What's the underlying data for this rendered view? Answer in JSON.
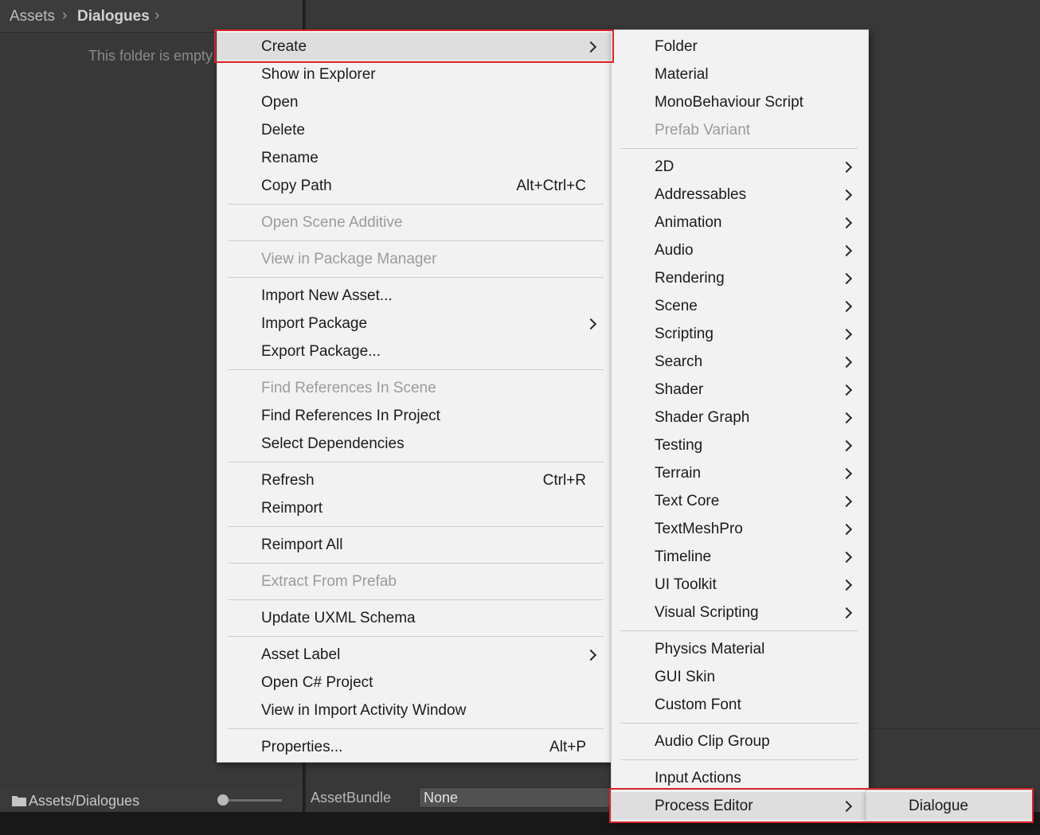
{
  "breadcrumb": {
    "root": "Assets",
    "current": "Dialogues"
  },
  "project": {
    "empty_message": "This folder is empty",
    "bottom_path": "Assets/Dialogues",
    "folder_icon": "folder-icon"
  },
  "inspector": {
    "assetbundle_label": "AssetBundle",
    "assetbundle_value": "None"
  },
  "context_menu": {
    "items": [
      {
        "label": "Create",
        "submenu": true,
        "highlighted": true
      },
      {
        "label": "Show in Explorer"
      },
      {
        "label": "Open"
      },
      {
        "label": "Delete"
      },
      {
        "label": "Rename"
      },
      {
        "label": "Copy Path",
        "shortcut": "Alt+Ctrl+C"
      },
      {
        "label": "Open Scene Additive",
        "disabled": true
      },
      {
        "label": "View in Package Manager",
        "disabled": true
      },
      {
        "label": "Import New Asset..."
      },
      {
        "label": "Import Package",
        "submenu": true
      },
      {
        "label": "Export Package..."
      },
      {
        "label": "Find References In Scene",
        "disabled": true
      },
      {
        "label": "Find References In Project"
      },
      {
        "label": "Select Dependencies"
      },
      {
        "label": "Refresh",
        "shortcut": "Ctrl+R"
      },
      {
        "label": "Reimport"
      },
      {
        "label": "Reimport All"
      },
      {
        "label": "Extract From Prefab",
        "disabled": true
      },
      {
        "label": "Update UXML Schema"
      },
      {
        "label": "Asset Label",
        "submenu": true
      },
      {
        "label": "Open C# Project"
      },
      {
        "label": "View in Import Activity Window"
      },
      {
        "label": "Properties...",
        "shortcut": "Alt+P"
      }
    ]
  },
  "create_submenu": {
    "items": [
      {
        "label": "Folder"
      },
      {
        "label": "Material"
      },
      {
        "label": "MonoBehaviour Script"
      },
      {
        "label": "Prefab Variant",
        "disabled": true
      },
      {
        "label": "2D",
        "submenu": true
      },
      {
        "label": "Addressables",
        "submenu": true
      },
      {
        "label": "Animation",
        "submenu": true
      },
      {
        "label": "Audio",
        "submenu": true
      },
      {
        "label": "Rendering",
        "submenu": true
      },
      {
        "label": "Scene",
        "submenu": true
      },
      {
        "label": "Scripting",
        "submenu": true
      },
      {
        "label": "Search",
        "submenu": true
      },
      {
        "label": "Shader",
        "submenu": true
      },
      {
        "label": "Shader Graph",
        "submenu": true
      },
      {
        "label": "Testing",
        "submenu": true
      },
      {
        "label": "Terrain",
        "submenu": true
      },
      {
        "label": "Text Core",
        "submenu": true
      },
      {
        "label": "TextMeshPro",
        "submenu": true
      },
      {
        "label": "Timeline",
        "submenu": true
      },
      {
        "label": "UI Toolkit",
        "submenu": true
      },
      {
        "label": "Visual Scripting",
        "submenu": true
      },
      {
        "label": "Physics Material"
      },
      {
        "label": "GUI Skin"
      },
      {
        "label": "Custom Font"
      },
      {
        "label": "Audio Clip Group"
      },
      {
        "label": "Input Actions"
      },
      {
        "label": "Process Editor",
        "submenu": true,
        "highlighted": true
      }
    ]
  },
  "process_submenu": {
    "items": [
      {
        "label": "Dialogue",
        "highlighted": true
      }
    ]
  },
  "colors": {
    "annotation": "#d8232a",
    "menu_bg": "#f2f2f2",
    "highlight_bg": "#dedede",
    "disabled_text": "#9b9b9b"
  }
}
